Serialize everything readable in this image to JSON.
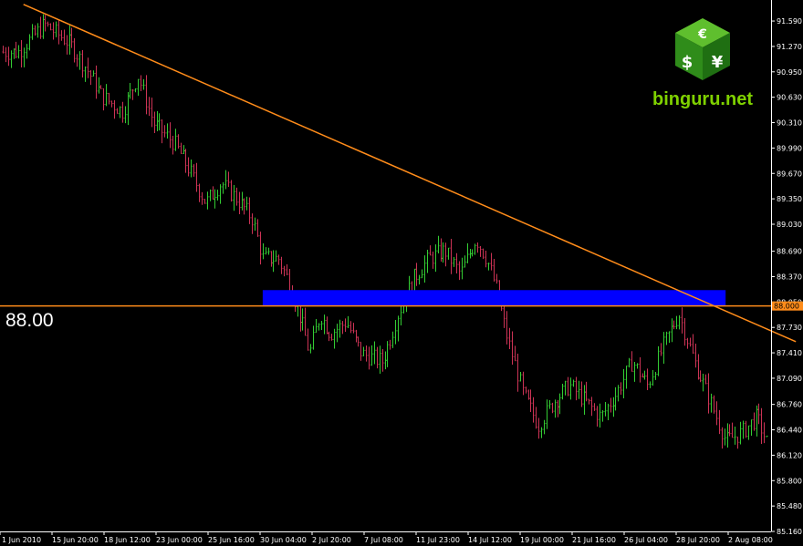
{
  "chart_data": {
    "type": "candlestick",
    "title": "",
    "xlabel": "",
    "ylabel": "",
    "ylim": [
      85.16,
      91.74
    ],
    "y_ticks": [
      "91.590",
      "91.270",
      "90.950",
      "90.630",
      "90.310",
      "89.990",
      "89.670",
      "89.350",
      "89.030",
      "88.690",
      "88.370",
      "88.050",
      "87.730",
      "87.410",
      "87.090",
      "86.760",
      "86.440",
      "86.120",
      "85.800",
      "85.480",
      "85.160"
    ],
    "x_ticks": [
      "1 Jun 2010",
      "15 Jun 20:00",
      "18 Jun 12:00",
      "23 Jun 00:00",
      "25 Jun 16:00",
      "30 Jun 04:00",
      "2 Jul 20:00",
      "7 Jul 08:00",
      "11 Jul 23:00",
      "14 Jul 12:00",
      "19 Jul 00:00",
      "21 Jul 16:00",
      "26 Jul 04:00",
      "28 Jul 20:00",
      "2 Aug 08:00"
    ],
    "horizontal_level": {
      "value": 88.0,
      "label": "88.00",
      "axis_label": "88.000",
      "color": "#ff8c1a"
    },
    "trendline": {
      "from": [
        0.1,
        91.8
      ],
      "to": [
        14.95,
        87.55
      ],
      "color": "#ff8c1a"
    },
    "zone": {
      "x_from": 4.7,
      "x_to": 13.6,
      "y_from": 88.0,
      "y_to": 88.2,
      "color": "#0000ff"
    },
    "path": [
      [
        0.0,
        91.2
      ],
      [
        0.5,
        91.55
      ],
      [
        1.0,
        91.3
      ],
      [
        1.3,
        91.0
      ],
      [
        1.6,
        90.65
      ],
      [
        2.0,
        90.45
      ],
      [
        2.3,
        90.9
      ],
      [
        2.6,
        90.3
      ],
      [
        3.0,
        90.05
      ],
      [
        3.3,
        89.7
      ],
      [
        3.6,
        89.3
      ],
      [
        3.9,
        89.55
      ],
      [
        4.2,
        89.35
      ],
      [
        4.5,
        89.1
      ],
      [
        4.7,
        88.6
      ],
      [
        5.0,
        88.6
      ],
      [
        5.2,
        88.3
      ],
      [
        5.4,
        87.9
      ],
      [
        5.6,
        87.4
      ],
      [
        5.8,
        87.9
      ],
      [
        6.0,
        87.65
      ],
      [
        6.3,
        87.8
      ],
      [
        6.6,
        87.4
      ],
      [
        7.0,
        87.3
      ],
      [
        7.3,
        87.9
      ],
      [
        7.6,
        88.35
      ],
      [
        7.9,
        88.6
      ],
      [
        8.2,
        88.7
      ],
      [
        8.5,
        88.4
      ],
      [
        8.8,
        88.85
      ],
      [
        9.0,
        88.6
      ],
      [
        9.2,
        88.2
      ],
      [
        9.4,
        87.6
      ],
      [
        9.7,
        86.9
      ],
      [
        10.0,
        86.5
      ],
      [
        10.3,
        86.8
      ],
      [
        10.6,
        87.0
      ],
      [
        10.9,
        86.8
      ],
      [
        11.2,
        86.6
      ],
      [
        11.5,
        86.9
      ],
      [
        11.8,
        87.3
      ],
      [
        12.1,
        87.0
      ],
      [
        12.4,
        87.5
      ],
      [
        12.7,
        87.9
      ],
      [
        13.0,
        87.3
      ],
      [
        13.3,
        86.8
      ],
      [
        13.6,
        86.3
      ],
      [
        13.9,
        86.4
      ],
      [
        14.2,
        86.6
      ],
      [
        14.5,
        86.1
      ],
      [
        14.7,
        85.5
      ],
      [
        14.95,
        86.15
      ]
    ]
  },
  "logo": {
    "brand": "binguru.net",
    "symbols": [
      "€",
      "$",
      "¥"
    ]
  }
}
